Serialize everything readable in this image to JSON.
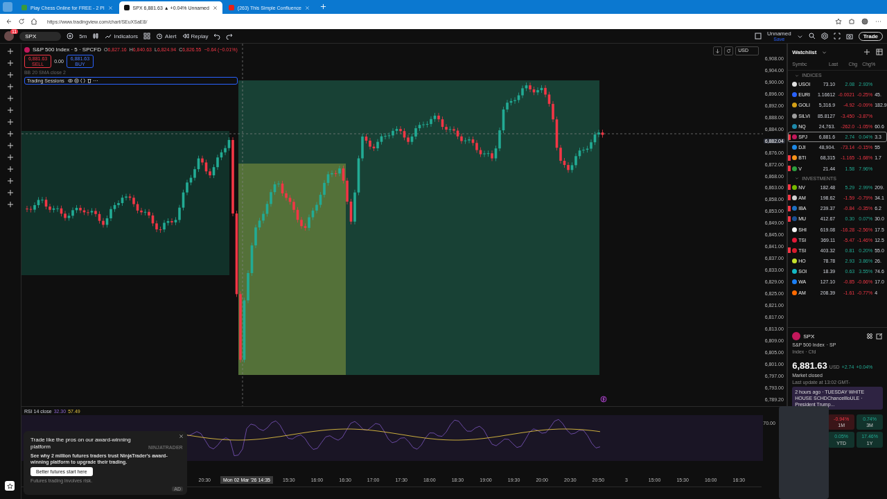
{
  "browser": {
    "tabs": [
      {
        "title": "Play Chess Online for FREE - 2 Pl",
        "selected": false
      },
      {
        "title": "SPX 6,881.63 ▲ +0.04% Unnamed",
        "selected": true
      },
      {
        "title": "(263) This Simple Confluence",
        "selected": false
      }
    ],
    "address": "https://www.tradingview.com/chart/SEuXSaE8/"
  },
  "toolbar": {
    "notification_count": "11",
    "symbol": "SPX",
    "interval": "5m",
    "indicators": "Indicators",
    "alert": "Alert",
    "replay": "Replay",
    "layout_name": "Unnamed",
    "layout_status": "Save",
    "trade": "Trade"
  },
  "legend": {
    "title": "S&P 500 Index · 5 · SPCFD",
    "ohlc": [
      {
        "key": "O",
        "value": "6,827.16"
      },
      {
        "key": "H",
        "value": "6,840.63"
      },
      {
        "key": "L",
        "value": "6,824.94"
      },
      {
        "key": "C",
        "value": "6,826.55"
      }
    ],
    "change": "−0.64 (−0.01%)",
    "sell_price": "6,881.63",
    "sell_label": "SELL",
    "spread": "0.00",
    "buy_price": "6,881.63",
    "buy_label": "BUY",
    "hidden_indicator": "BB 20 SMA close 2",
    "sessions_indicator": "Trading Sessions",
    "currency": "USD"
  },
  "price_axis": [
    {
      "label": "6,908.00",
      "kind": "tick"
    },
    {
      "label": "6,904.00",
      "kind": "tick"
    },
    {
      "label": "6,900.00",
      "kind": "tick"
    },
    {
      "label": "6,896.00",
      "kind": "tick"
    },
    {
      "label": "6,892.00",
      "kind": "tick"
    },
    {
      "label": "6,888.00",
      "kind": "tick"
    },
    {
      "label": "6,884.00",
      "kind": "tick"
    },
    {
      "label": "6,882.04",
      "kind": "current"
    },
    {
      "label": "6,876.00",
      "kind": "tick"
    },
    {
      "label": "6,872.00",
      "kind": "tick"
    },
    {
      "label": "6,868.00",
      "kind": "tick"
    },
    {
      "label": "6,863.00",
      "kind": "tick"
    },
    {
      "label": "6,858.00",
      "kind": "tick"
    },
    {
      "label": "6,853.00",
      "kind": "tick"
    },
    {
      "label": "6,849.00",
      "kind": "tick"
    },
    {
      "label": "6,845.00",
      "kind": "tick"
    },
    {
      "label": "6,841.00",
      "kind": "tick"
    },
    {
      "label": "6,837.00",
      "kind": "tick"
    },
    {
      "label": "6,833.00",
      "kind": "tick"
    },
    {
      "label": "6,829.00",
      "kind": "tick"
    },
    {
      "label": "6,825.00",
      "kind": "tick"
    },
    {
      "label": "6,821.00",
      "kind": "tick"
    },
    {
      "label": "6,817.00",
      "kind": "tick"
    },
    {
      "label": "6,813.00",
      "kind": "tick"
    },
    {
      "label": "6,809.00",
      "kind": "tick"
    },
    {
      "label": "6,805.00",
      "kind": "tick"
    },
    {
      "label": "6,801.00",
      "kind": "tick"
    },
    {
      "label": "6,797.00",
      "kind": "tick"
    },
    {
      "label": "6,793.00",
      "kind": "tick"
    },
    {
      "label": "6,789.20",
      "kind": "tick"
    }
  ],
  "rsi": {
    "name": "RSI 14 close",
    "value": "32.30",
    "average": "57.49",
    "axis_label": "70.00"
  },
  "time_axis": [
    {
      "label": "20:30",
      "kind": "tick"
    },
    {
      "label": "Mon 02 Mar '26",
      "time": "14:35",
      "kind": "crosshair"
    },
    {
      "label": "15:30",
      "kind": "tick"
    },
    {
      "label": "16:00",
      "kind": "tick"
    },
    {
      "label": "16:30",
      "kind": "tick"
    },
    {
      "label": "17:00",
      "kind": "tick"
    },
    {
      "label": "17:30",
      "kind": "tick"
    },
    {
      "label": "18:00",
      "kind": "tick"
    },
    {
      "label": "18:30",
      "kind": "tick"
    },
    {
      "label": "19:00",
      "kind": "tick"
    },
    {
      "label": "19:30",
      "kind": "tick"
    },
    {
      "label": "20:00",
      "kind": "tick"
    },
    {
      "label": "20:30",
      "kind": "tick"
    },
    {
      "label": "20:50",
      "kind": "tick"
    },
    {
      "label": "3",
      "kind": "tick"
    },
    {
      "label": "15:00",
      "kind": "tick"
    },
    {
      "label": "15:30",
      "kind": "tick"
    },
    {
      "label": "16:00",
      "kind": "tick"
    },
    {
      "label": "16:30",
      "kind": "tick"
    }
  ],
  "ad": {
    "title": "Trade like the pros on our award-winning platform",
    "brand": "NINJATRADER",
    "body": "See why 2 million futures traders trust NinjaTrader's award-winning platform to upgrade their trading.",
    "button": "Better futures start here",
    "disclaimer": "Futures trading involves risk.",
    "badge": "AD"
  },
  "watchlist": {
    "title": "Watchlist",
    "columns": [
      "Symbc",
      "Last",
      "Chg",
      "Chg%"
    ],
    "sections": [
      {
        "name": "INDICES",
        "rows": [
          {
            "symbol": "USOI",
            "last": "73.10",
            "chg": "2.08",
            "chgp": "2.93%",
            "column_5": "",
            "color": "#e0e0e0",
            "flagged": false,
            "selected": false
          },
          {
            "symbol": "EURI",
            "last": "1.16612",
            "chg": "-0.0021",
            "chgp": "-0.25%",
            "column_5": "45.",
            "color": "#2962ff",
            "flagged": false,
            "selected": false
          },
          {
            "symbol": "GOLI",
            "last": "5,316.9",
            "chg": "-4.92",
            "chgp": "-0.09%",
            "column_5": "182.9",
            "color": "#d4a017",
            "flagged": false,
            "selected": false
          },
          {
            "symbol": "SILVI",
            "last": "85.8127",
            "chg": "-3.450",
            "chgp": "-3.87%",
            "column_5": "",
            "color": "#9e9e9e",
            "flagged": false,
            "selected": false
          },
          {
            "symbol": "NQ",
            "last": "24,763.",
            "chg": "-262.0",
            "chgp": "-1.05%",
            "column_5": "60.6",
            "color": "#1e88a8",
            "flagged": false,
            "selected": false
          },
          {
            "symbol": "SPJ",
            "last": "6,881.6",
            "chg": "2.74",
            "chgp": "0.04%",
            "column_5": "3.3",
            "color": "#c2185b",
            "flagged": true,
            "selected": true
          },
          {
            "symbol": "DJI",
            "last": "48,904.",
            "chg": "-73.14",
            "chgp": "-0.15%",
            "column_5": "55",
            "color": "#1e88e5",
            "flagged": false,
            "selected": false
          },
          {
            "symbol": "BTI",
            "last": "68,315",
            "chg": "-1.165",
            "chgp": "-1.68%",
            "column_5": "1.7",
            "color": "#f7931a",
            "flagged": true,
            "selected": false
          },
          {
            "symbol": "V",
            "last": "21.44",
            "chg": "1.58",
            "chgp": "7.96%",
            "column_5": "",
            "color": "#2e9e3e",
            "flagged": true,
            "selected": false
          }
        ]
      },
      {
        "name": "INVESTMENTS",
        "rows": [
          {
            "symbol": "NV",
            "last": "182.48",
            "chg": "5.29",
            "chgp": "2.99%",
            "column_5": "209.",
            "color": "#76b900",
            "flagged": true,
            "selected": false
          },
          {
            "symbol": "AM",
            "last": "198.62",
            "chg": "-1.59",
            "chgp": "-0.79%",
            "column_5": "34.1",
            "color": "#d0d0d0",
            "flagged": true,
            "selected": false
          },
          {
            "symbol": "IBA",
            "last": "239.37",
            "chg": "-0.84",
            "chgp": "-0.35%",
            "column_5": "6.2",
            "color": "#1f70c1",
            "flagged": true,
            "selected": false
          },
          {
            "symbol": "MU",
            "last": "412.67",
            "chg": "0.30",
            "chgp": "0.07%",
            "column_5": "30.0",
            "color": "#1d4f91",
            "flagged": true,
            "selected": false
          },
          {
            "symbol": "SHI",
            "last": "619.08",
            "chg": "-16.28",
            "chgp": "-2.56%",
            "column_5": "17.5",
            "color": "#f5f5f5",
            "flagged": false,
            "selected": false
          },
          {
            "symbol": "TSI",
            "last": "369.11",
            "chg": "-5.47",
            "chgp": "-1.46%",
            "column_5": "12.5",
            "color": "#e31937",
            "flagged": false,
            "selected": false
          },
          {
            "symbol": "TSI",
            "last": "403.32",
            "chg": "0.81",
            "chgp": "0.20%",
            "column_5": "55.0",
            "color": "#d81b2c",
            "flagged": true,
            "selected": false
          },
          {
            "symbol": "HO",
            "last": "78.78",
            "chg": "2.93",
            "chgp": "3.86%",
            "column_5": "26.",
            "color": "#c6e12b",
            "flagged": false,
            "selected": false
          },
          {
            "symbol": "SOI",
            "last": "18.39",
            "chg": "0.63",
            "chgp": "3.55%",
            "column_5": "74.6",
            "color": "#14b8c4",
            "flagged": false,
            "selected": false
          },
          {
            "symbol": "WA",
            "last": "127.10",
            "chg": "-0.85",
            "chgp": "-0.66%",
            "column_5": "17.0",
            "color": "#1b7ff5",
            "flagged": false,
            "selected": false
          },
          {
            "symbol": "AM",
            "last": "208.39",
            "chg": "-1.61",
            "chgp": "-0.77%",
            "column_5": "4",
            "color": "#ff6a00",
            "flagged": false,
            "selected": false
          }
        ]
      }
    ]
  },
  "details": {
    "symbol": "SPX",
    "name": "S&P 500 Index",
    "exchange": "· SP",
    "type": "Index · Cfd",
    "price": "6,881.63",
    "currency": "USD",
    "change": "+2.74",
    "change_percent": "+0.04%",
    "status": "Market closed",
    "update": "Last update at 13:02 GMT-",
    "news": "2 hours ago · TUESDAY WHITE HOUSE SCHDChancellloULE · President Trump...",
    "performance": [
      {
        "value": "-0.94%",
        "period": "1M"
      },
      {
        "value": "0.74%",
        "period": "3M"
      },
      {
        "value": "0.05%",
        "period": "YTD"
      },
      {
        "value": "17.46%",
        "period": "1Y"
      }
    ]
  }
}
